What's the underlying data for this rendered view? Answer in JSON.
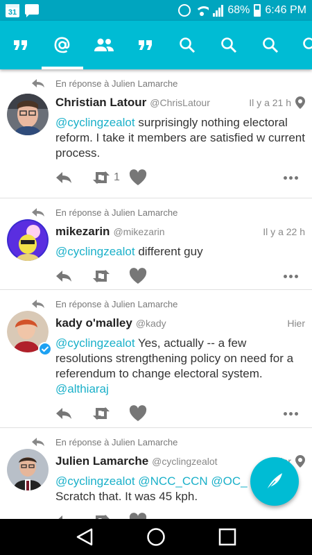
{
  "status_bar": {
    "calendar_day": "31",
    "battery": "68%",
    "time": "6:46 PM",
    "icons": [
      "calendar-icon",
      "chat-icon",
      "alarm-icon",
      "wifi-icon",
      "signal-icon",
      "battery-icon"
    ]
  },
  "tabs": [
    {
      "name": "quote",
      "icon": "quote-icon"
    },
    {
      "name": "mentions",
      "icon": "at-icon",
      "active": true
    },
    {
      "name": "people",
      "icon": "people-icon"
    },
    {
      "name": "quote-2",
      "icon": "quote-icon"
    },
    {
      "name": "search-1",
      "icon": "search-icon"
    },
    {
      "name": "search-2",
      "icon": "search-icon"
    },
    {
      "name": "search-3",
      "icon": "search-icon"
    },
    {
      "name": "search-4",
      "icon": "search-icon"
    }
  ],
  "colors": {
    "status_bar": "#00a5bf",
    "tab_bar": "#00bcd4",
    "mention": "#1ab0c9",
    "verified": "#1da1f2"
  },
  "tweets": [
    {
      "reply_context": "En réponse à Julien Lamarche",
      "name": "Christian Latour",
      "handle": "@ChrisLatour",
      "time": "Il y a 21 h",
      "has_location": true,
      "mention": "@cyclingzealot",
      "text": " surprisingly nothing electoral reform. I take it members are satisfied w current process.",
      "retweet_count": "1"
    },
    {
      "reply_context": "En réponse à Julien Lamarche",
      "name": "mikezarin",
      "handle": "@mikezarin",
      "time": "Il y a 22 h",
      "mention": "@cyclingzealot",
      "text": " different guy"
    },
    {
      "reply_context": "En réponse à Julien Lamarche",
      "name": "kady o'malley",
      "handle": "@kady",
      "time": "Hier",
      "verified": true,
      "mention": "@cyclingzealot",
      "text": " Yes, actually -- a few resolutions strengthening policy on need for a referendum to change electoral system. ",
      "mention_end": "@althiaraj"
    },
    {
      "reply_context": "En réponse à Julien Lamarche",
      "name": "Julien Lamarche",
      "handle": "@cyclingzealot",
      "time": "Hier",
      "has_location": true,
      "mention": "@cyclingzealot @NCC_CCN @OC_",
      "text": "Scratch that.  It was 45 kph."
    }
  ],
  "fab": {
    "icon": "feather-compose-icon"
  },
  "nav": {
    "buttons": [
      "back-icon",
      "home-icon",
      "recents-icon"
    ]
  }
}
